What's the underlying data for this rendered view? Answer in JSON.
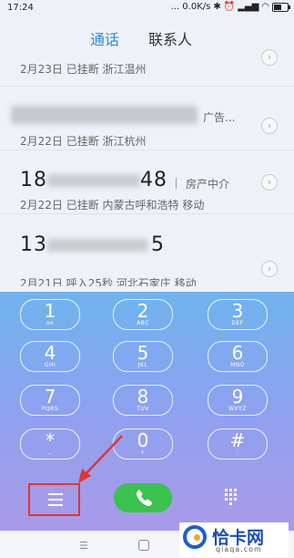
{
  "status_bar": {
    "time": "17:24",
    "network_speed": "... 0.0K/s",
    "icons": [
      "bluetooth-icon",
      "alarm-icon",
      "signal-icon",
      "wifi-icon",
      "battery-icon"
    ],
    "battery_level": 0.6
  },
  "tabs": [
    {
      "label": "通话",
      "active": true
    },
    {
      "label": "联系人",
      "active": false
    }
  ],
  "call_log": [
    {
      "number": "",
      "tag": "",
      "detail": "2月23日 已挂断 浙江温州"
    },
    {
      "number": "",
      "tag": "广告...",
      "detail": "2月22日 已挂断 浙江杭州"
    },
    {
      "number": "18",
      "number_tail": "48",
      "tag": "房产中介",
      "detail": "2月22日 已挂断 内蒙古呼和浩特 移动"
    },
    {
      "number": "13",
      "number_tail": "5",
      "tag": "",
      "detail": "2月21日 呼入25秒 河北石家庄 移动"
    }
  ],
  "dialpad": {
    "keys": [
      {
        "digit": "1",
        "letters": "oo"
      },
      {
        "digit": "2",
        "letters": "ABC"
      },
      {
        "digit": "3",
        "letters": "DEF"
      },
      {
        "digit": "4",
        "letters": "GHI"
      },
      {
        "digit": "5",
        "letters": "JKL"
      },
      {
        "digit": "6",
        "letters": "MNO"
      },
      {
        "digit": "7",
        "letters": "PQRS"
      },
      {
        "digit": "8",
        "letters": "TUV"
      },
      {
        "digit": "9",
        "letters": "WXYZ"
      },
      {
        "digit": "*",
        "letters": ","
      },
      {
        "digit": "0",
        "letters": "+"
      },
      {
        "digit": "#",
        "letters": ";"
      }
    ]
  },
  "bottom_actions": {
    "menu_icon": "menu-icon",
    "call_icon": "phone-icon",
    "keypad_icon": "keypad-grid-icon"
  },
  "watermark": {
    "name": "恰卡网",
    "url": "qiaqa.com"
  },
  "colors": {
    "accent": "#2a8ad9",
    "call_green": "#39c24d",
    "highlight_red": "#e3342f"
  }
}
